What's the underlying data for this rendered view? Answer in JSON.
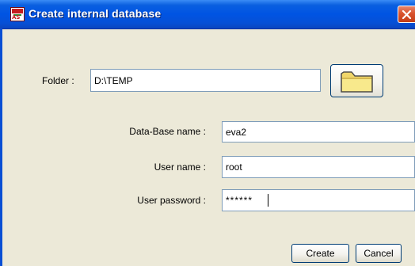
{
  "window": {
    "title": "Create internal database",
    "icon": "app-icon",
    "icon_text": "AS"
  },
  "form": {
    "folder_label": "Folder :",
    "folder_value": "D:\\TEMP",
    "dbname_label": "Data-Base name :",
    "dbname_value": "eva2",
    "username_label": "User name :",
    "username_value": "root",
    "password_label": "User password :",
    "password_value": "******"
  },
  "buttons": {
    "create_label": "Create",
    "cancel_label": "Cancel",
    "browse_icon": "folder-icon"
  },
  "colors": {
    "titlebar": "#0054e3",
    "dialog_bg": "#ece9d8",
    "close_red": "#d9532e",
    "field_border": "#7f9db9",
    "folder_yellow": "#f5e27a"
  }
}
